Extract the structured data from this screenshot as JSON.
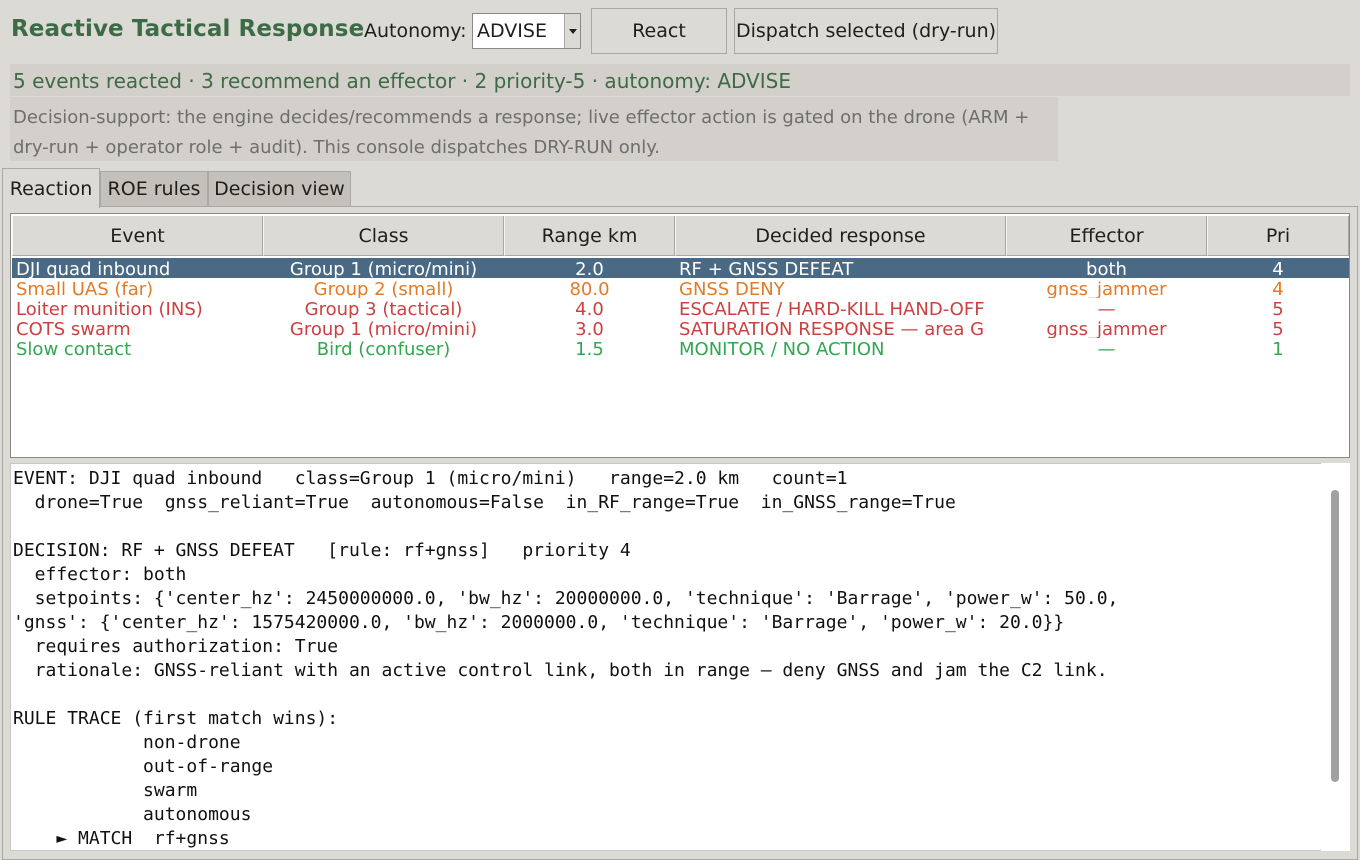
{
  "app": {
    "title": "Reactive Tactical Response"
  },
  "toolbar": {
    "autonomy_label": "Autonomy:",
    "autonomy_value": "ADVISE",
    "react_label": "React",
    "dispatch_label": "Dispatch selected (dry-run)"
  },
  "status": {
    "summary": "5 events reacted · 3 recommend an effector · 2 priority-5 · autonomy: ADVISE",
    "note_line1": "Decision-support: the engine decides/recommends a response; live effector action is gated on the drone (ARM +",
    "note_line2": "dry-run + operator role + audit). This console dispatches DRY-RUN only."
  },
  "tabs": [
    {
      "label": "Reaction",
      "active": true
    },
    {
      "label": "ROE rules",
      "active": false
    },
    {
      "label": "Decision view",
      "active": false
    }
  ],
  "table": {
    "columns": [
      "Event",
      "Class",
      "Range km",
      "Decided response",
      "Effector",
      "Pri"
    ],
    "rows": [
      {
        "event": "DJI quad inbound",
        "class": "Group 1 (micro/mini)",
        "range": "2.0",
        "response": "RF + GNSS DEFEAT",
        "effector": "both",
        "pri": "4",
        "color": "#ffffff",
        "selected": true
      },
      {
        "event": "Small UAS (far)",
        "class": "Group 2 (small)",
        "range": "80.0",
        "response": "GNSS DENY",
        "effector": "gnss_jammer",
        "pri": "4",
        "color": "#e07b28",
        "selected": false
      },
      {
        "event": "Loiter munition (INS)",
        "class": "Group 3 (tactical)",
        "range": "4.0",
        "response": "ESCALATE / HARD-KILL HAND-OFF",
        "effector": "—",
        "pri": "5",
        "color": "#cc4040",
        "selected": false
      },
      {
        "event": "COTS swarm",
        "class": "Group 1 (micro/mini)",
        "range": "3.0",
        "response": "SATURATION RESPONSE — area G",
        "effector": "gnss_jammer",
        "pri": "5",
        "color": "#cc4040",
        "selected": false
      },
      {
        "event": "Slow contact",
        "class": "Bird (confuser)",
        "range": "1.5",
        "response": "MONITOR / NO ACTION",
        "effector": "—",
        "pri": "1",
        "color": "#2fa84f",
        "selected": false
      }
    ]
  },
  "detail": {
    "lines": [
      "EVENT: DJI quad inbound   class=Group 1 (micro/mini)   range=2.0 km   count=1",
      "  drone=True  gnss_reliant=True  autonomous=False  in_RF_range=True  in_GNSS_range=True",
      "",
      "DECISION: RF + GNSS DEFEAT   [rule: rf+gnss]   priority 4",
      "  effector: both",
      "  setpoints: {'center_hz': 2450000000.0, 'bw_hz': 20000000.0, 'technique': 'Barrage', 'power_w': 50.0,",
      "'gnss': {'center_hz': 1575420000.0, 'bw_hz': 2000000.0, 'technique': 'Barrage', 'power_w': 20.0}}",
      "  requires authorization: True",
      "  rationale: GNSS-reliant with an active control link, both in range — deny GNSS and jam the C2 link.",
      "",
      "RULE TRACE (first match wins):",
      "            non-drone",
      "            out-of-range",
      "            swarm",
      "            autonomous",
      "    ► MATCH  rf+gnss"
    ]
  }
}
